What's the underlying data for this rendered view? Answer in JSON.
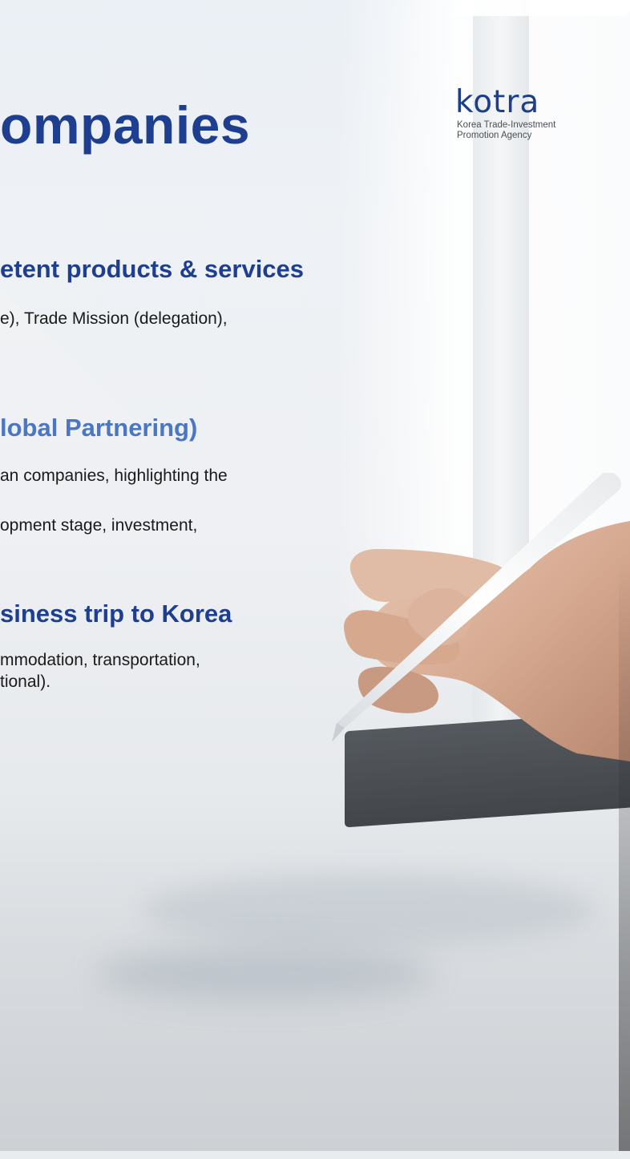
{
  "slide": {
    "title": "ompanies",
    "logo": {
      "name": "kotra",
      "subtitle_line1": "Korea Trade-Investment",
      "subtitle_line2": "Promotion Agency"
    },
    "sections": [
      {
        "heading": "etent products & services",
        "lines": [
          "e), Trade Mission (delegation),"
        ]
      },
      {
        "heading": "lobal Partnering)",
        "lines": [
          "an companies, highlighting the",
          "opment stage, investment,"
        ]
      },
      {
        "heading": "siness trip to Korea",
        "lines": [
          "mmodation, transportation,",
          "tional)."
        ]
      }
    ]
  },
  "colors": {
    "title": "#1e3f8f",
    "heading_dark": "#1e3f8f",
    "heading_light": "#4a76c2",
    "body_text": "#1a1a1a",
    "logo": "#1d3e8a"
  },
  "icons": [
    "kotra-logo",
    "hand-with-stylus-photo"
  ]
}
